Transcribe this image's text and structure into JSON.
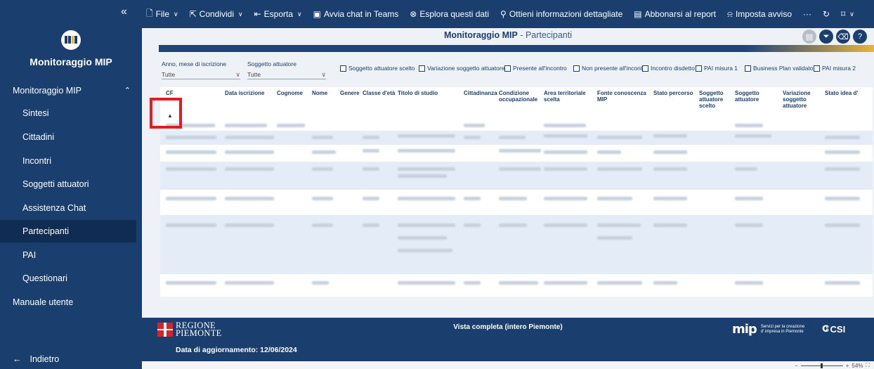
{
  "sidebar": {
    "collapse": "«",
    "app_name": "Monitoraggio MIP",
    "section": "Monitoraggio MIP",
    "items": [
      {
        "label": "Sintesi",
        "active": false
      },
      {
        "label": "Cittadini",
        "active": false
      },
      {
        "label": "Incontri",
        "active": false
      },
      {
        "label": "Soggetti attuatori",
        "active": false
      },
      {
        "label": "Assistenza Chat",
        "active": false
      },
      {
        "label": "Partecipanti",
        "active": true
      },
      {
        "label": "PAI",
        "active": false
      },
      {
        "label": "Questionari",
        "active": false
      }
    ],
    "manual": "Manuale utente",
    "back": "Indietro"
  },
  "toolbar": {
    "items": [
      {
        "label": "File",
        "icon": "file-icon",
        "dropdown": true
      },
      {
        "label": "Condividi",
        "icon": "share-icon",
        "dropdown": true
      },
      {
        "label": "Esporta",
        "icon": "export-icon",
        "dropdown": true
      },
      {
        "label": "Avvia chat in Teams",
        "icon": "teams-icon",
        "dropdown": false
      },
      {
        "label": "Esplora questi dati",
        "icon": "explore-icon",
        "dropdown": false
      },
      {
        "label": "Ottieni informazioni dettagliate",
        "icon": "lightbulb-icon",
        "dropdown": false
      },
      {
        "label": "Abbonarsi al report",
        "icon": "subscribe-icon",
        "dropdown": false
      },
      {
        "label": "Imposta avviso",
        "icon": "bell-icon",
        "dropdown": false
      }
    ],
    "more": "···"
  },
  "report": {
    "title": "Monitoraggio MIP",
    "separator": " - ",
    "subtitle": "Partecipanti",
    "filters": {
      "anno_label": "Anno, mese di iscrizione",
      "anno_value": "Tutte",
      "soggetto_label": "Soggetto attuatore",
      "soggetto_value": "Tutte"
    },
    "checkboxes": [
      "Soggetto attuatore scelto",
      "Variazione soggetto attuatore",
      "Presente all'incontro",
      "Non presente all'incontro",
      "Incontro disdetto",
      "PAI misura 1",
      "Business Plan validato",
      "PAI misura 2"
    ],
    "columns": [
      "CF",
      "Data iscrizione",
      "Cognome",
      "Nome",
      "Genere",
      "Classe d'età",
      "Titolo di studio",
      "Cittadinanza",
      "Condizione occupazionale",
      "Area territoriale scelta",
      "Fonte conoscenza MIP",
      "Stato percorso",
      "Soggetto attuatore scelto",
      "Soggetto attuatore",
      "Variazione soggetto attuatore",
      "Stato idea d'"
    ]
  },
  "footer": {
    "region_line1": "REGIONE",
    "region_line2": "PIEMONTE",
    "center": "Vista completa (intero Piemonte)",
    "update": "Data di aggiornamento: 12/06/2024",
    "mip": "mip",
    "mip_tag1": "Servizi per la creazione",
    "mip_tag2": "d' impresa in Piemonte",
    "csi": "CSI"
  },
  "status": {
    "zoom": "54%"
  },
  "colors": {
    "primary": "#1a3f6f",
    "accent_red": "#e31b23",
    "row_shade": "#e4edf7"
  }
}
